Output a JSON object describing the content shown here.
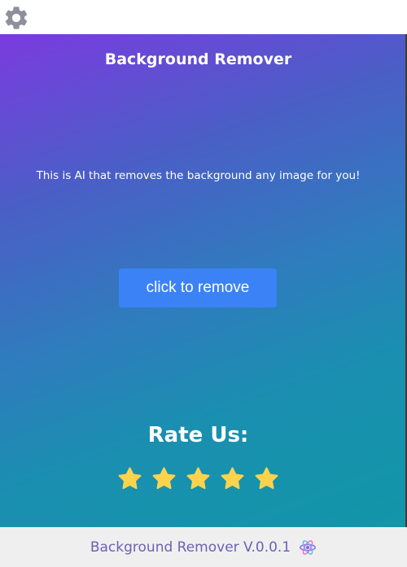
{
  "app": {
    "title": "Background Remover",
    "description": "This is AI that removes the background any image for you!",
    "action_button_label": "click to remove",
    "rate_heading": "Rate Us:",
    "rating_stars": 5,
    "footer_text": "Background Remover V.0.0.1"
  },
  "icons": {
    "settings": "gear-icon",
    "star": "star-icon",
    "footer_logo": "atom-icon"
  },
  "colors": {
    "gradient_start": "#7b3be0",
    "gradient_end": "#1296a8",
    "button": "#3b82f6",
    "star": "#fcd34d",
    "footer_text": "#6b62b4",
    "gear": "#8f8f9c"
  }
}
